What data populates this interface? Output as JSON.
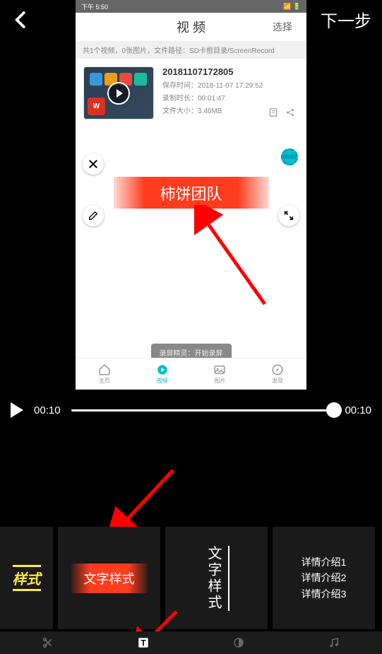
{
  "topbar": {
    "next_label": "下一步"
  },
  "preview": {
    "status_time": "下午 5:50",
    "header_title": "视 频",
    "select_label": "选择",
    "file_path_text": "共1个视频，0张图片，文件路径：SD卡根目录/ScreenRecord",
    "video": {
      "name": "20181107172805",
      "save_time_label": "保存时间：2018-11-07 17:29:52",
      "duration_label": "录制时长：00:01:47",
      "size_label": "文件大小：3.46MB"
    },
    "overlay_text": "柿饼团队",
    "timer_text": "00:00",
    "toast_text": "录屏精灵：开始录屏",
    "nav": {
      "home": "主页",
      "video": "视频",
      "image": "图片",
      "discover": "发现"
    }
  },
  "player": {
    "current_time": "00:10",
    "total_time": "00:10"
  },
  "styles": {
    "style1": "样式",
    "style2": "文字样式",
    "style3": "文字样式",
    "style4_line1": "详情介绍1",
    "style4_line2": "详情介绍2",
    "style4_line3": "详情介绍3"
  }
}
